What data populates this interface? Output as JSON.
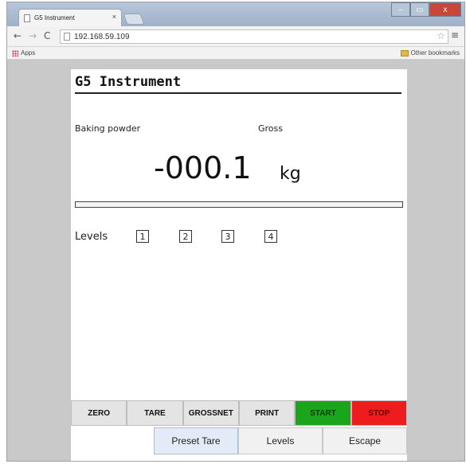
{
  "browser": {
    "tab_title": "G5 Instrument",
    "tab_close": "×",
    "url": "192.168.59.109",
    "bookmarks_apps": "Apps",
    "bookmarks_other": "Other bookmarks",
    "nav": {
      "back": "←",
      "forward": "→",
      "reload": "C"
    },
    "star": "☆",
    "menu": "≡",
    "window_controls": {
      "minimize": "–",
      "maximize": "▭",
      "close": "x"
    }
  },
  "app": {
    "title": "G5 Instrument",
    "product": "Baking powder",
    "mode": "Gross",
    "weight": "-000.1",
    "unit": "kg",
    "levels_label": "Levels",
    "levels": [
      "1",
      "2",
      "3",
      "4"
    ]
  },
  "function_buttons": [
    "ZERO",
    "TARE",
    "GROSSNET",
    "PRINT",
    "START",
    "STOP"
  ],
  "softkeys": [
    "Preset Tare",
    "Levels",
    "Escape"
  ],
  "colors": {
    "start": "#1aa51a",
    "stop": "#ee1c1c"
  }
}
